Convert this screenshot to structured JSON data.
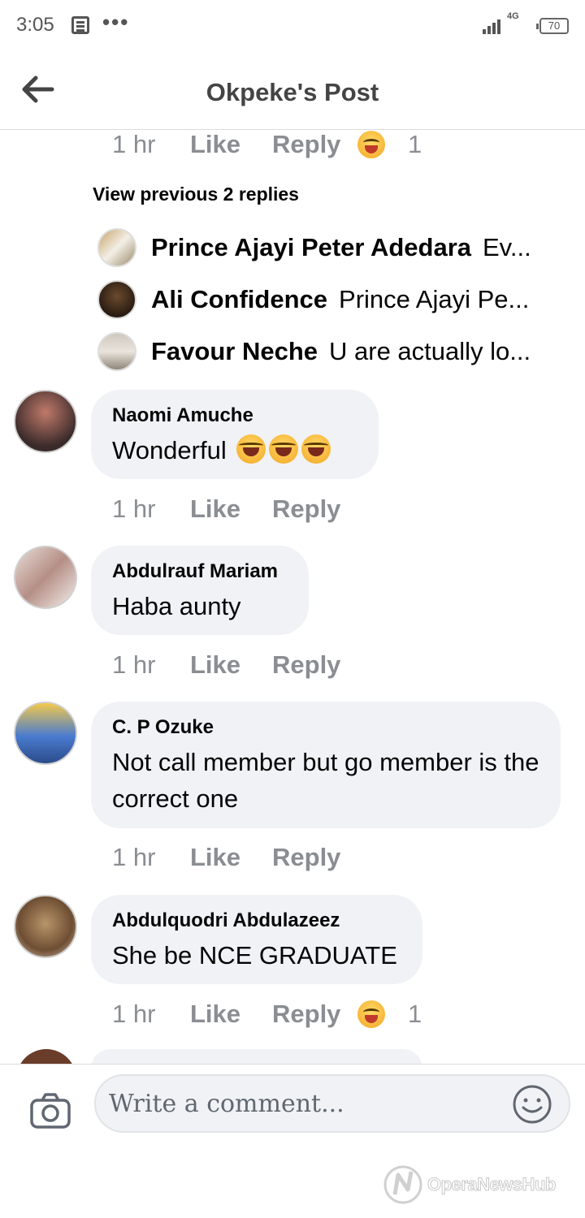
{
  "status_bar": {
    "time": "3:05",
    "dots": "•••",
    "network": "4G",
    "battery": "70"
  },
  "header": {
    "title": "Okpeke's Post"
  },
  "top_actions": {
    "time": "1 hr",
    "like": "Like",
    "reply": "Reply",
    "reaction_count": "1"
  },
  "view_previous": "View previous 2 replies",
  "reply_previews": [
    {
      "name": "Prince Ajayi Peter Adedara",
      "text": "Ev..."
    },
    {
      "name": "Ali Confidence",
      "text": "Prince Ajayi Pe..."
    },
    {
      "name": "Favour Neche",
      "text": "U are actually lo..."
    }
  ],
  "comments": [
    {
      "name": "Naomi Amuche",
      "text": "Wonderful",
      "time": "1 hr",
      "like": "Like",
      "reply": "Reply"
    },
    {
      "name": "Abdulrauf Mariam",
      "text": "Haba aunty",
      "time": "1 hr",
      "like": "Like",
      "reply": "Reply"
    },
    {
      "name": "C. P Ozuke",
      "text": "Not call member but go member is the correct one",
      "time": "1 hr",
      "like": "Like",
      "reply": "Reply"
    },
    {
      "name": "Abdulquodri Abdulazeez",
      "text": "She be NCE GRADUATE",
      "time": "1 hr",
      "like": "Like",
      "reply": "Reply",
      "reaction_count": "1"
    }
  ],
  "composer": {
    "placeholder": "Write a comment..."
  },
  "watermark": "OperaNewsHub",
  "colors": {
    "bubble": "#f0f2f5",
    "meta_text": "#8a8d91",
    "reaction": "#f5a623"
  }
}
